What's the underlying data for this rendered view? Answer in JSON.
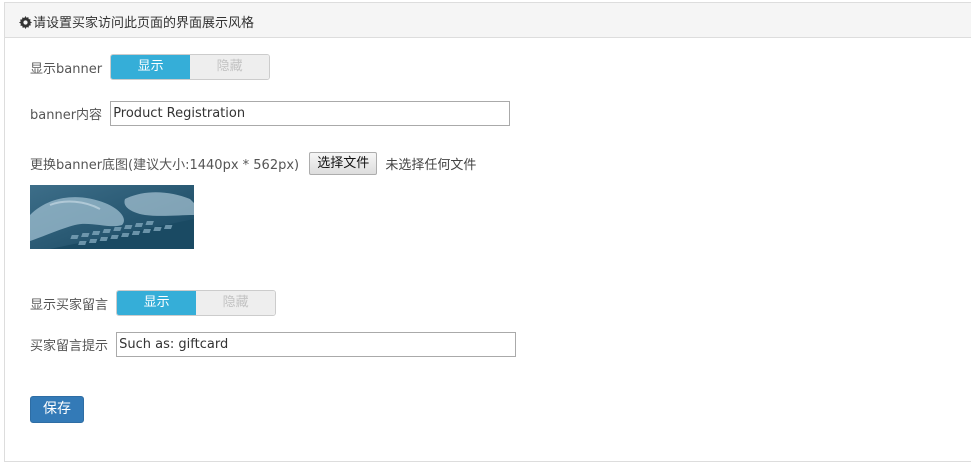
{
  "panel": {
    "title": "请设置买家访问此页面的界面展示风格",
    "icon": "gear-icon"
  },
  "show_banner": {
    "label": "显示banner",
    "on_label": "显示",
    "off_label": "隐藏",
    "selected": "显示"
  },
  "banner_content": {
    "label": "banner内容",
    "value": "Product Registration"
  },
  "banner_image": {
    "label": "更换banner底图(建议大小:1440px * 562px)",
    "file_button": "选择文件",
    "file_status": "未选择任何文件",
    "preview": "keyboard-typing-image"
  },
  "show_message": {
    "label": "显示买家留言",
    "on_label": "显示",
    "off_label": "隐藏",
    "selected": "显示"
  },
  "message_hint": {
    "label": "买家留言提示",
    "value": "Such as: giftcard"
  },
  "save_button": {
    "label": "保存"
  },
  "colors": {
    "toggle_active": "#35aed8",
    "save_button": "#337ab7"
  }
}
